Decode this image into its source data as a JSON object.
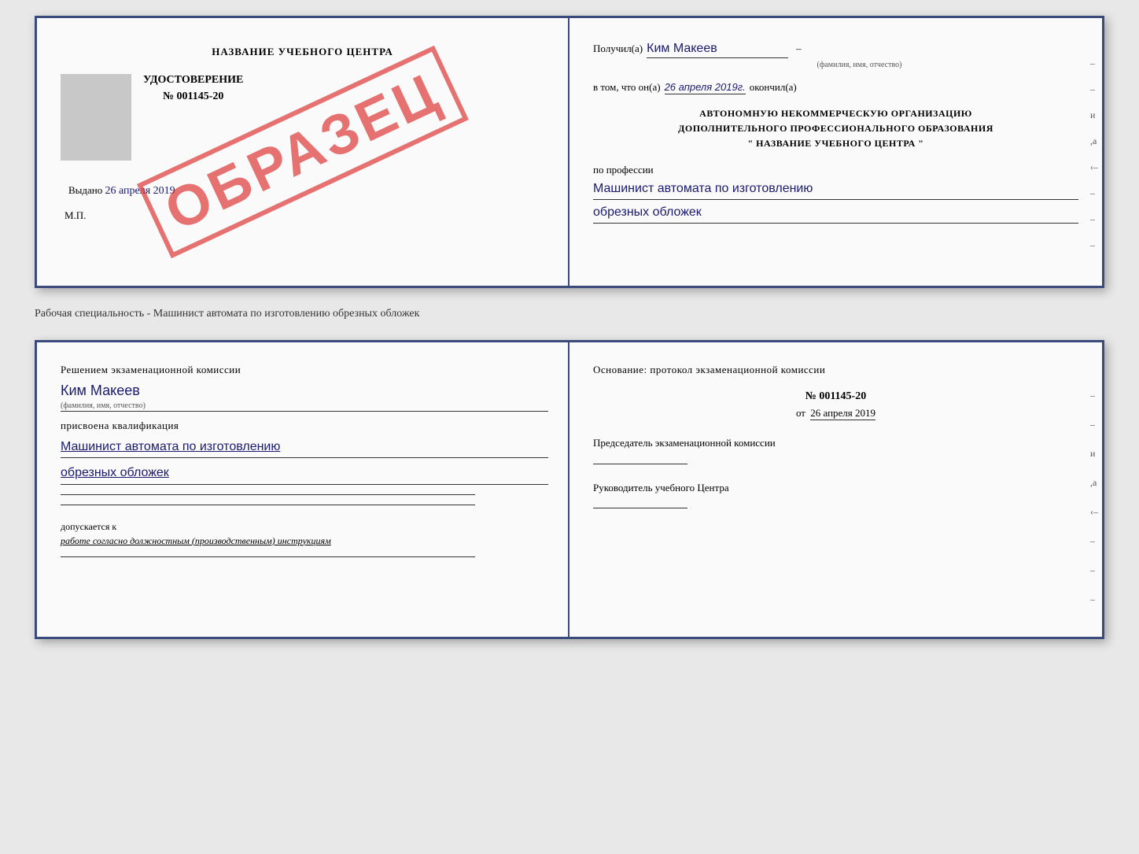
{
  "top_doc": {
    "left": {
      "title": "НАЗВАНИЕ УЧЕБНОГО ЦЕНТРА",
      "watermark": "ОБРАЗЕЦ",
      "udostoverenie_label": "УДОСТОВЕРЕНИЕ",
      "number": "№ 001145-20",
      "vydano": "Выдано",
      "vydano_date": "26 апреля 2019",
      "mp": "М.П."
    },
    "right": {
      "poluchil": "Получил(а)",
      "name_handwritten": "Ким Макеев",
      "fio_caption": "(фамилия, имя, отчество)",
      "vtom": "в том, что он(а)",
      "date_handwritten": "26 апреля 2019г.",
      "okonchil": "окончил(а)",
      "org_line1": "АВТОНОМНУЮ НЕКОММЕРЧЕСКУЮ ОРГАНИЗАЦИЮ",
      "org_line2": "ДОПОЛНИТЕЛЬНОГО ПРОФЕССИОНАЛЬНОГО ОБРАЗОВАНИЯ",
      "org_name": "\"  НАЗВАНИЕ УЧЕБНОГО ЦЕНТРА  \"",
      "po_professii": "по профессии",
      "profession_line1": "Машинист автомата по изготовлению",
      "profession_line2": "обрезных обложек",
      "right_marks": [
        "–",
        "–",
        "и",
        ",а",
        "‹–",
        "–",
        "–",
        "–",
        "–"
      ]
    }
  },
  "between_text": "Рабочая специальность - Машинист автомата по изготовлению обрезных обложек",
  "bottom_doc": {
    "left": {
      "resheniem": "Решением экзаменационной комиссии",
      "person_name": "Ким Макеев",
      "fio_caption": "(фамилия, имя, отчество)",
      "prisvoena": "присвоена квалификация",
      "qualification_line1": "Машинист автомата по изготовлению",
      "qualification_line2": "обрезных обложек",
      "dopuskaetsya_prefix": "допускается к",
      "dopuskaetsya_text": "работе согласно должностным (производственным) инструкциям"
    },
    "right": {
      "osnovanie": "Основание: протокол экзаменационной комиссии",
      "protocol_number": "№  001145-20",
      "ot": "от",
      "protocol_date": "26 апреля 2019",
      "predsedatel_label": "Председатель экзаменационной комиссии",
      "rukovoditel_label": "Руководитель учебного Центра",
      "right_marks": [
        "–",
        "–",
        "и",
        ",а",
        "‹–",
        "–",
        "–",
        "–",
        "–"
      ]
    }
  }
}
